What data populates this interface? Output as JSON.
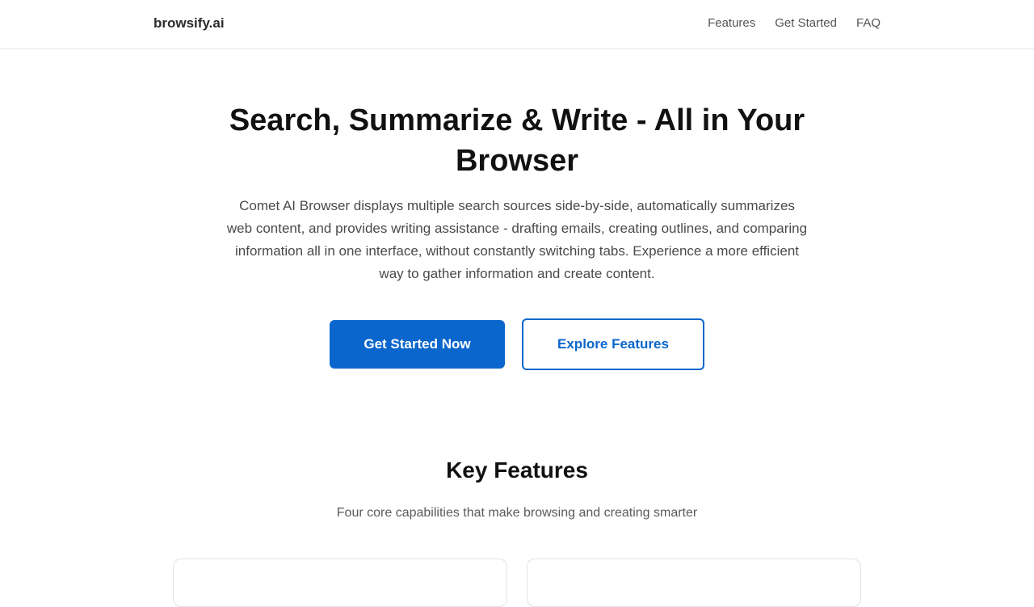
{
  "header": {
    "brand": "browsify.ai",
    "nav": [
      {
        "label": "Features"
      },
      {
        "label": "Get Started"
      },
      {
        "label": "FAQ"
      }
    ]
  },
  "hero": {
    "title_line1": "Search, Summarize & Write - All in Your",
    "title_line2": "Browser",
    "description": "Comet AI Browser displays multiple search sources side-by-side, automatically summarizes web content, and provides writing assistance - drafting emails, creating outlines, and comparing information all in one interface, without constantly switching tabs. Experience a more efficient way to gather information and create content.",
    "primary_button": "Get Started Now",
    "secondary_button": "Explore Features"
  },
  "features": {
    "title": "Key Features",
    "subtitle": "Four core capabilities that make browsing and creating smarter"
  },
  "colors": {
    "accent": "#0a66cc",
    "text": "#111111",
    "muted": "#555555",
    "border": "#e5e5e5"
  }
}
